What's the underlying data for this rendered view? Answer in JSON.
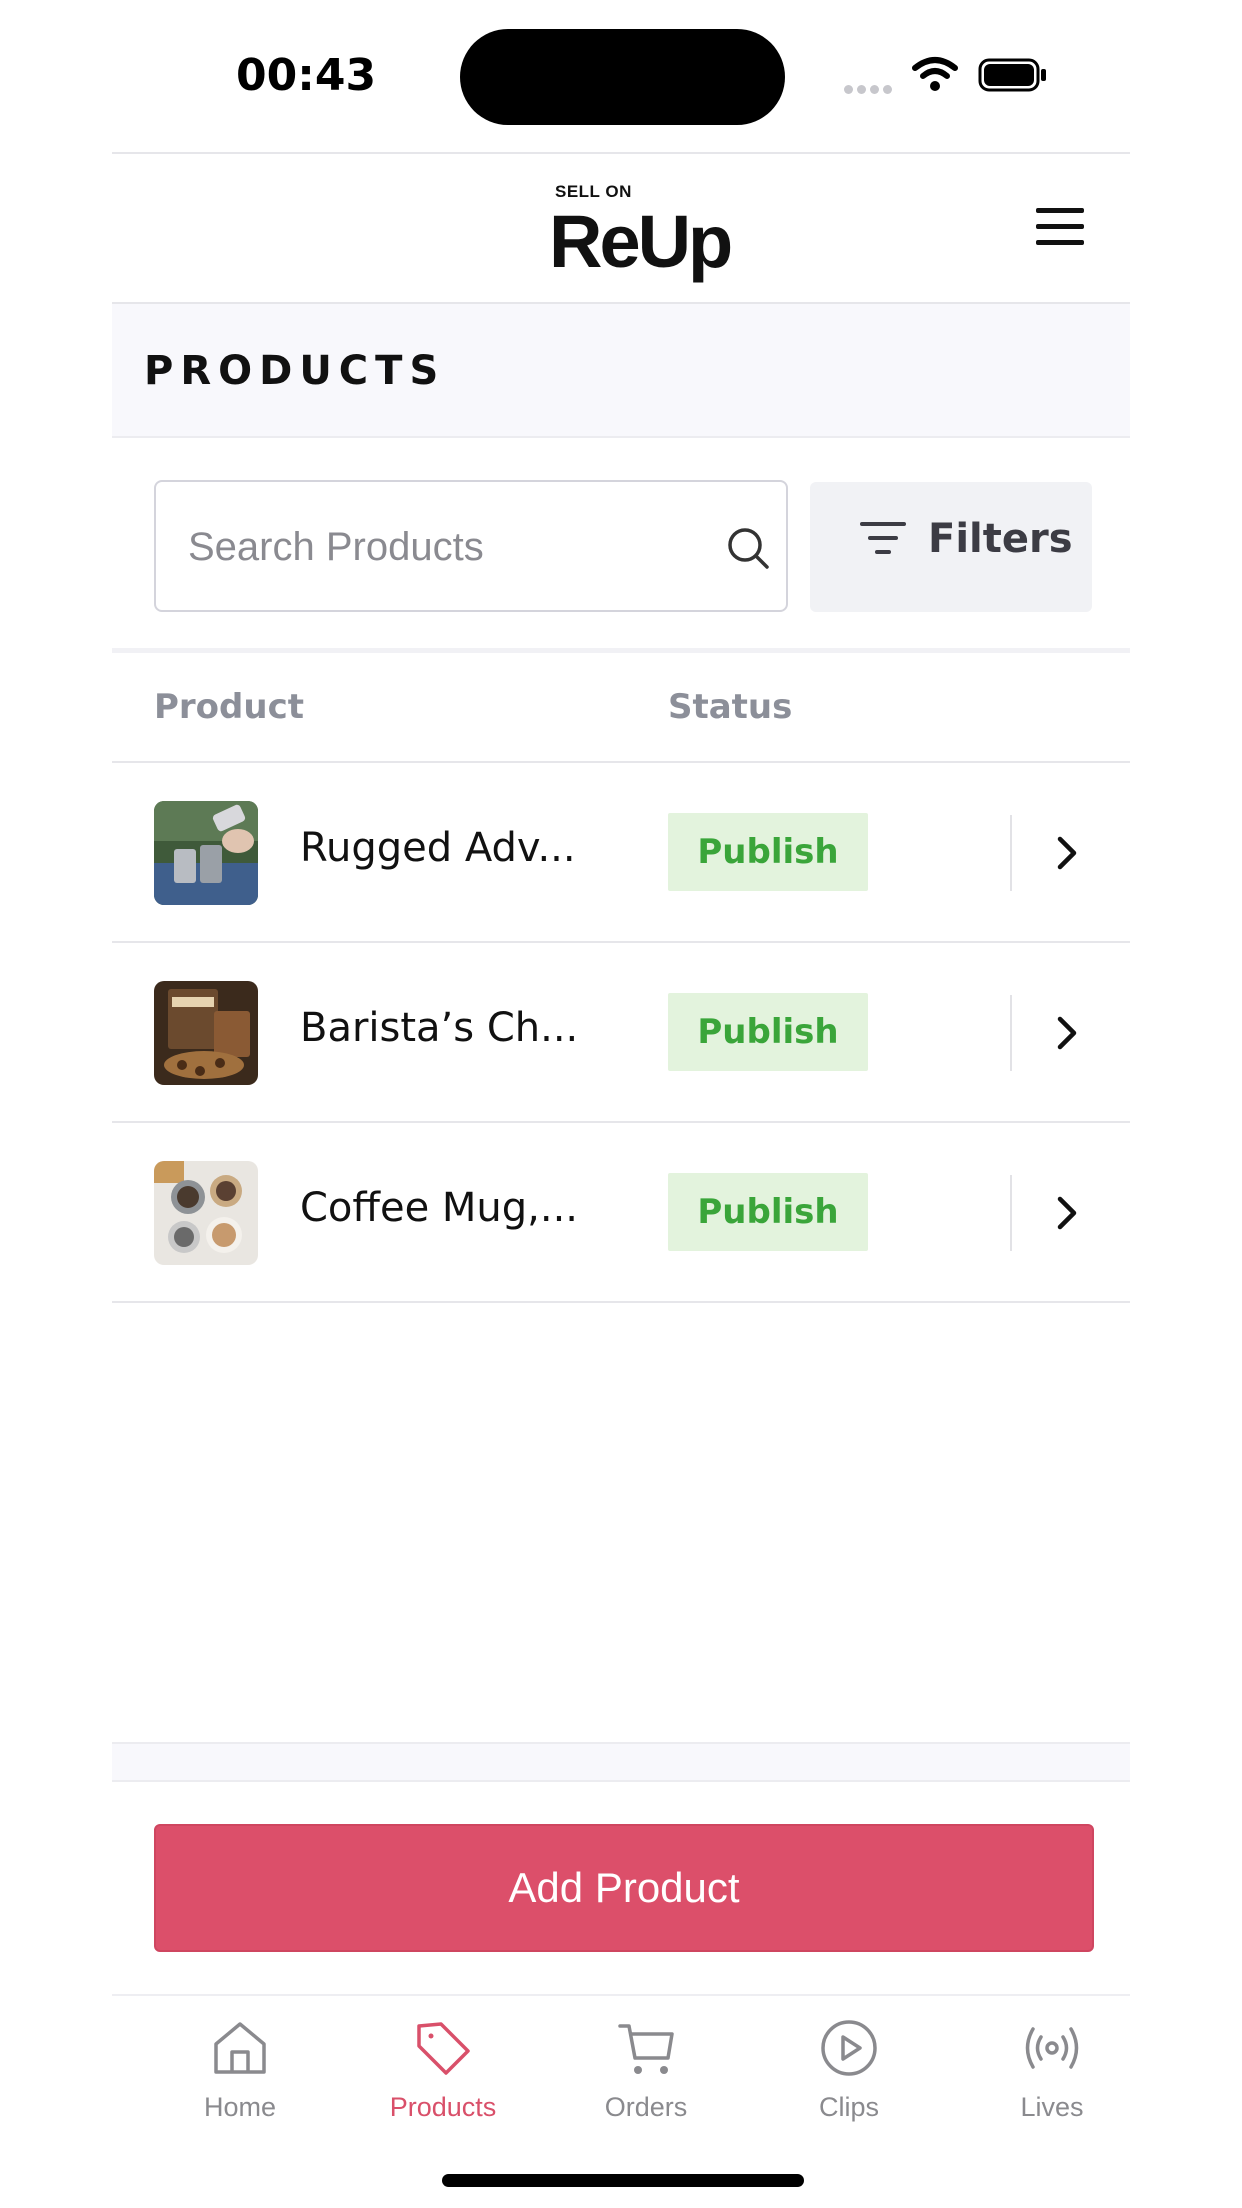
{
  "status_bar": {
    "time": "00:43"
  },
  "header": {
    "logo_small": "SELL ON",
    "logo_big": "ReUp",
    "menu_icon": "hamburger-menu-icon"
  },
  "page": {
    "title": "PRODUCTS"
  },
  "search": {
    "placeholder": "Search Products",
    "value": ""
  },
  "filters": {
    "label": "Filters"
  },
  "table": {
    "columns": [
      "Product",
      "Status"
    ],
    "rows": [
      {
        "name": "Rugged Adv...",
        "status": "Publish",
        "thumb": "camping-flask-photo"
      },
      {
        "name": "Barista’s Ch...",
        "status": "Publish",
        "thumb": "coffee-bag-photo"
      },
      {
        "name": "Coffee Mug,...",
        "status": "Publish",
        "thumb": "coffee-mugs-photo"
      }
    ]
  },
  "actions": {
    "add_product": "Add Product"
  },
  "tab_bar": {
    "tabs": [
      {
        "label": "Home",
        "icon": "home-icon",
        "active": false
      },
      {
        "label": "Products",
        "icon": "tag-icon",
        "active": true
      },
      {
        "label": "Orders",
        "icon": "cart-icon",
        "active": false
      },
      {
        "label": "Clips",
        "icon": "play-circle-icon",
        "active": false
      },
      {
        "label": "Lives",
        "icon": "broadcast-icon",
        "active": false
      }
    ]
  },
  "colors": {
    "accent": "#dc4f6a",
    "publish_bg": "#e3f3dd",
    "publish_text": "#3aa53a",
    "muted_text": "#8c8f99"
  }
}
